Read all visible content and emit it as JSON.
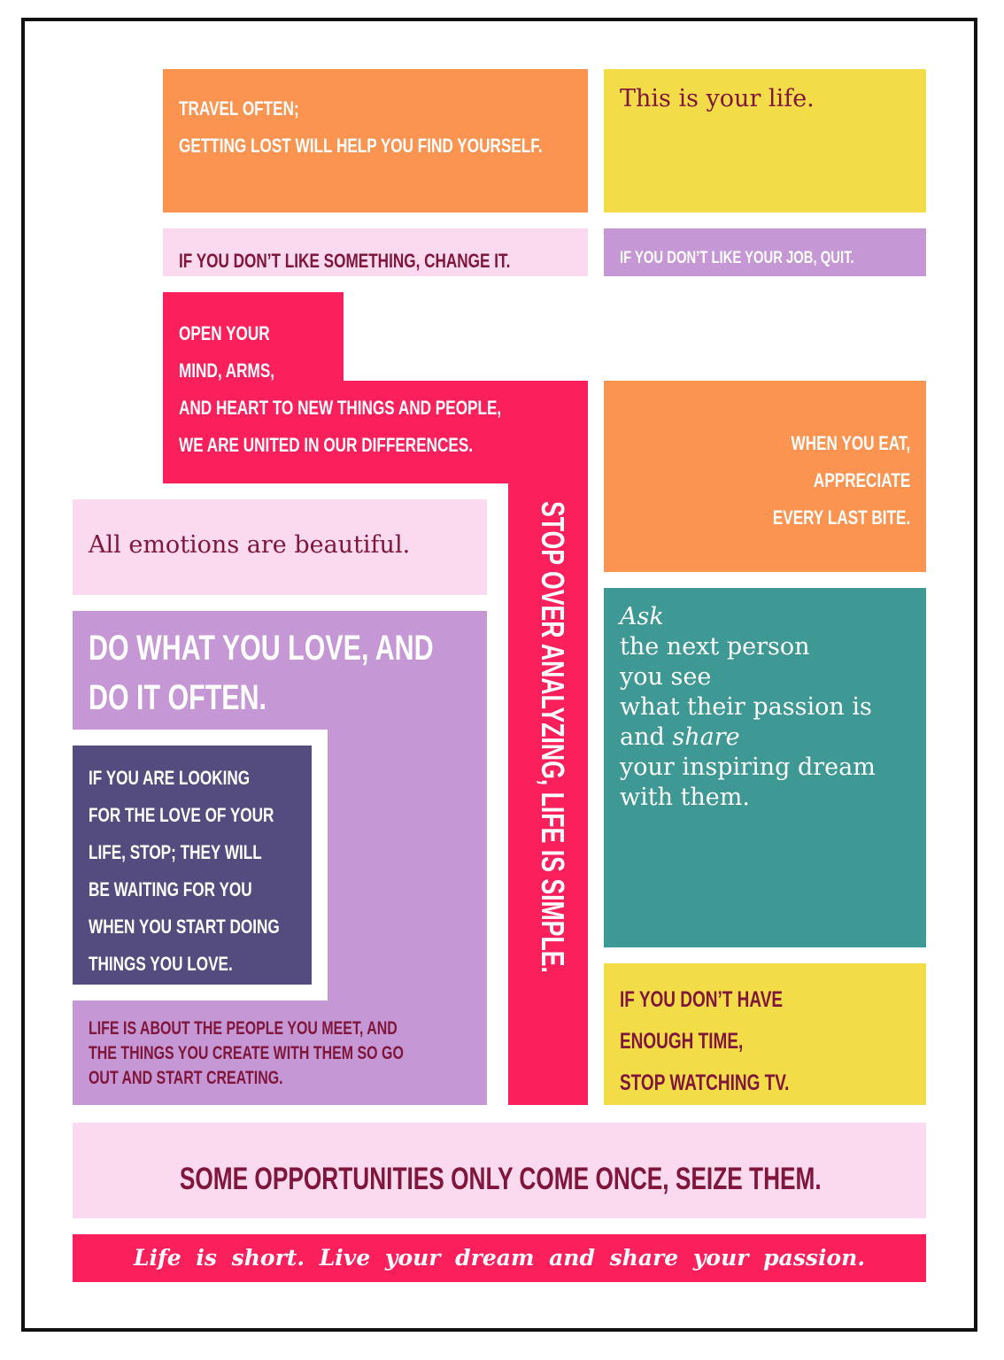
{
  "quotes": {
    "travel": [
      "TRAVEL OFTEN;",
      "GETTING LOST WILL HELP YOU FIND YOURSELF."
    ],
    "your_life": "This is your life.",
    "change_it": "IF YOU DON’T LIKE SOMETHING, CHANGE IT.",
    "quit_job": "IF YOU DON’T LIKE YOUR JOB, QUIT.",
    "open_mind": [
      "OPEN YOUR",
      "MIND, ARMS,",
      "AND HEART TO NEW THINGS AND PEOPLE,",
      "WE ARE UNITED IN OUR DIFFERENCES."
    ],
    "eat": [
      "WHEN YOU EAT,",
      "APPRECIATE",
      "EVERY LAST BITE."
    ],
    "emotions": "All emotions are beautiful.",
    "do_what": [
      "DO WHAT YOU LOVE, AND",
      "DO IT OFTEN."
    ],
    "ask": {
      "ask_word": "Ask",
      "line1": "the next person",
      "line2": "you see",
      "line3": "what their passion is",
      "and_word": "and ",
      "share_word": "share",
      "line5": "your inspiring dream",
      "line6": "with them."
    },
    "stop_analyzing": "STOP OVER ANALYZING, LIFE IS SIMPLE.",
    "love_of_life": [
      "IF YOU ARE LOOKING",
      "FOR THE LOVE OF YOUR",
      "LIFE, STOP; THEY WILL",
      "BE WAITING FOR YOU",
      "WHEN YOU START DOING",
      "THINGS YOU LOVE."
    ],
    "people_meet": [
      "LIFE IS ABOUT THE PEOPLE YOU MEET, AND",
      "THE THINGS YOU CREATE WITH THEM SO GO",
      "OUT AND START CREATING."
    ],
    "tv": [
      "IF YOU DON’T HAVE",
      "ENOUGH TIME,",
      "STOP WATCHING TV."
    ],
    "opportunities": "SOME OPPORTUNITIES ONLY COME ONCE, SEIZE THEM.",
    "life_short": "Life is short. Live your dream and share your passion."
  },
  "colors": {
    "orange": "#fb9450",
    "yellow": "#f2dd48",
    "pink": "#fbd9ee",
    "lavender": "#c597d5",
    "red": "#fb1f5b",
    "teal": "#3e9893",
    "indigo": "#544c7f",
    "maroon": "#80163b"
  }
}
